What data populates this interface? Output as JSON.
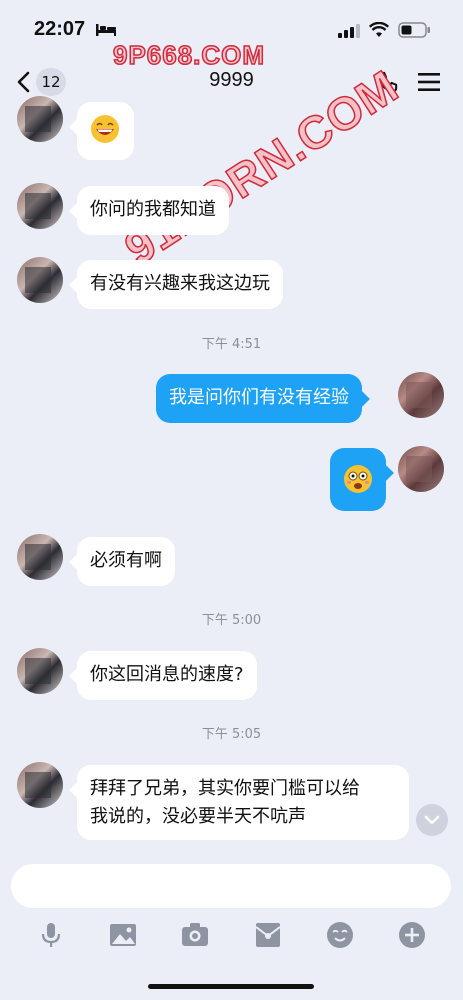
{
  "status_bar": {
    "time": "22:07",
    "icons": [
      "bed-icon",
      "signal-icon",
      "wifi-icon",
      "battery-icon"
    ]
  },
  "watermarks": [
    "9P668.COM",
    "91PORN.COM"
  ],
  "header": {
    "back_badge": "12",
    "title": "9999",
    "icons": [
      "back-chevron-icon",
      "phone-icon",
      "menu-icon"
    ]
  },
  "messages": [
    {
      "from": "other",
      "type": "emoji",
      "emoji": "grinning-face"
    },
    {
      "from": "other",
      "type": "text",
      "text": "你问的我都知道"
    },
    {
      "from": "other",
      "type": "text",
      "text": "有没有兴趣来我这边玩"
    },
    {
      "type": "time",
      "text": "下午 4:51"
    },
    {
      "from": "me",
      "type": "text",
      "text": "我是问你们有没有经验"
    },
    {
      "from": "me",
      "type": "emoji",
      "emoji": "astonished-face"
    },
    {
      "from": "other",
      "type": "text",
      "text": "必须有啊"
    },
    {
      "type": "time",
      "text": "下午 5:00"
    },
    {
      "from": "other",
      "type": "text",
      "text": "你这回消息的速度?"
    },
    {
      "type": "time",
      "text": "下午 5:05"
    },
    {
      "from": "other",
      "type": "text",
      "line1": "拜拜了兄弟，其实你要门槛可以给",
      "line2": "我说的，没必要半天不吭声"
    }
  ],
  "input": {
    "placeholder": ""
  },
  "toolbar": [
    "microphone-icon",
    "image-icon",
    "camera-icon",
    "red-packet-icon",
    "emoji-icon",
    "plus-icon"
  ],
  "colors": {
    "background": "#eceef7",
    "my_bubble": "#1ea2f5",
    "other_bubble": "#ffffff",
    "timestamp": "#8c8f99"
  }
}
